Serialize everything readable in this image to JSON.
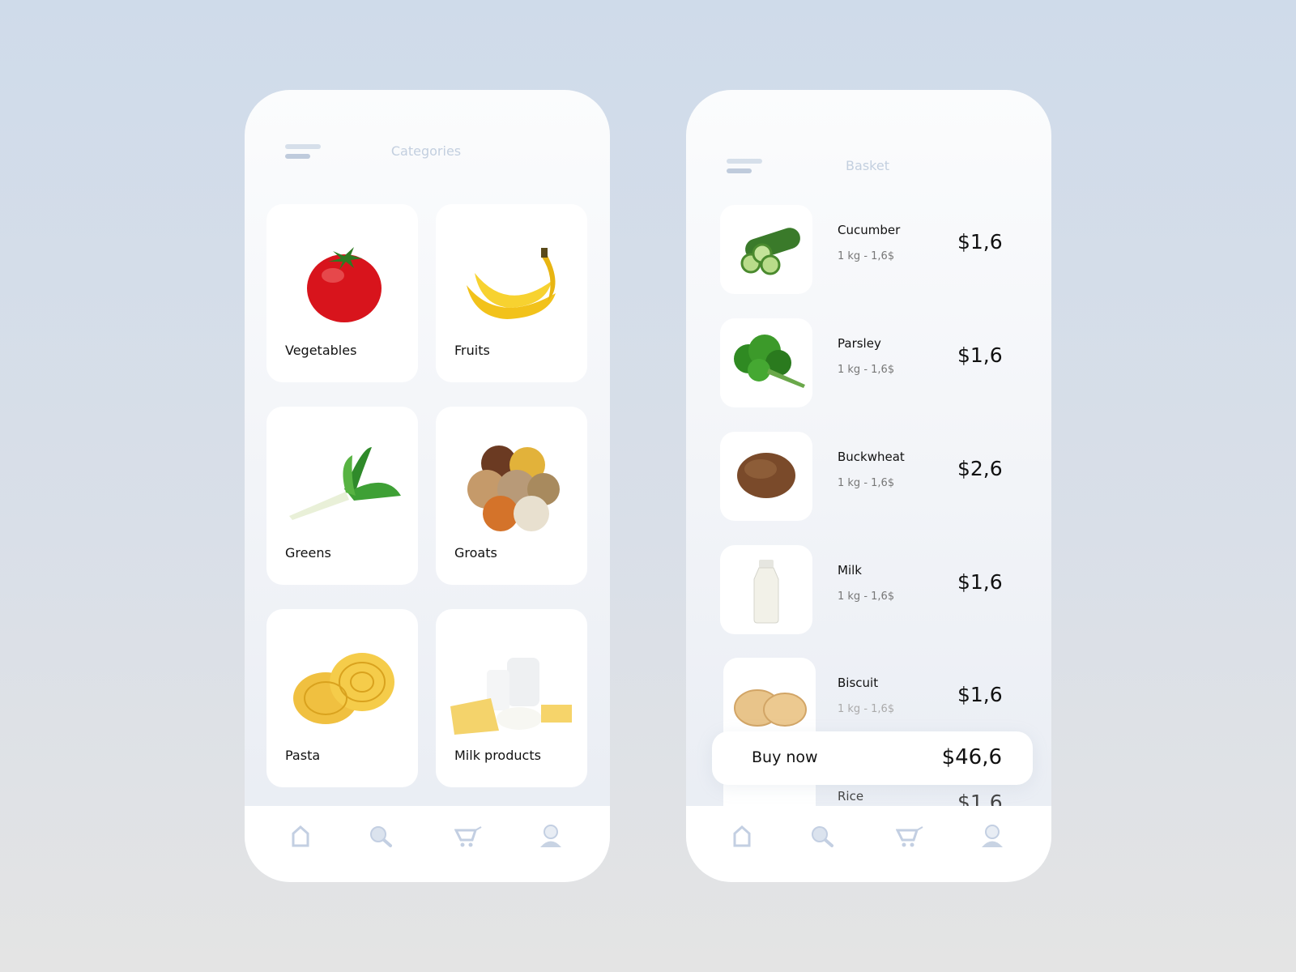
{
  "categories_screen": {
    "title": "Categories",
    "cards": [
      {
        "label": "Vegetables",
        "image": "tomato"
      },
      {
        "label": "Fruits",
        "image": "bananas"
      },
      {
        "label": "Greens",
        "image": "leek"
      },
      {
        "label": "Groats",
        "image": "grains"
      },
      {
        "label": "Pasta",
        "image": "tagliatelle"
      },
      {
        "label": "Milk products",
        "image": "dairy"
      }
    ]
  },
  "basket_screen": {
    "title": "Basket",
    "items": [
      {
        "name": "Cucumber",
        "unit": "1 kg - 1,6$",
        "price": "$1,6"
      },
      {
        "name": "Parsley",
        "unit": "1 kg - 1,6$",
        "price": "$1,6"
      },
      {
        "name": "Buckwheat",
        "unit": "1 kg - 1,6$",
        "price": "$2,6"
      },
      {
        "name": "Milk",
        "unit": "1 kg - 1,6$",
        "price": "$1,6"
      },
      {
        "name": "Biscuit",
        "unit": "1 kg - 1,6$",
        "price": "$1,6"
      },
      {
        "name": "Rice",
        "unit": "",
        "price": "$1,6"
      }
    ],
    "buy_label": "Buy now",
    "total": "$46,6"
  },
  "nav_icons": [
    "home-icon",
    "search-icon",
    "cart-icon",
    "profile-icon"
  ],
  "colors": {
    "icon": "#c3cfe2",
    "text": "#111111",
    "muted_title": "#c3cfdf"
  }
}
